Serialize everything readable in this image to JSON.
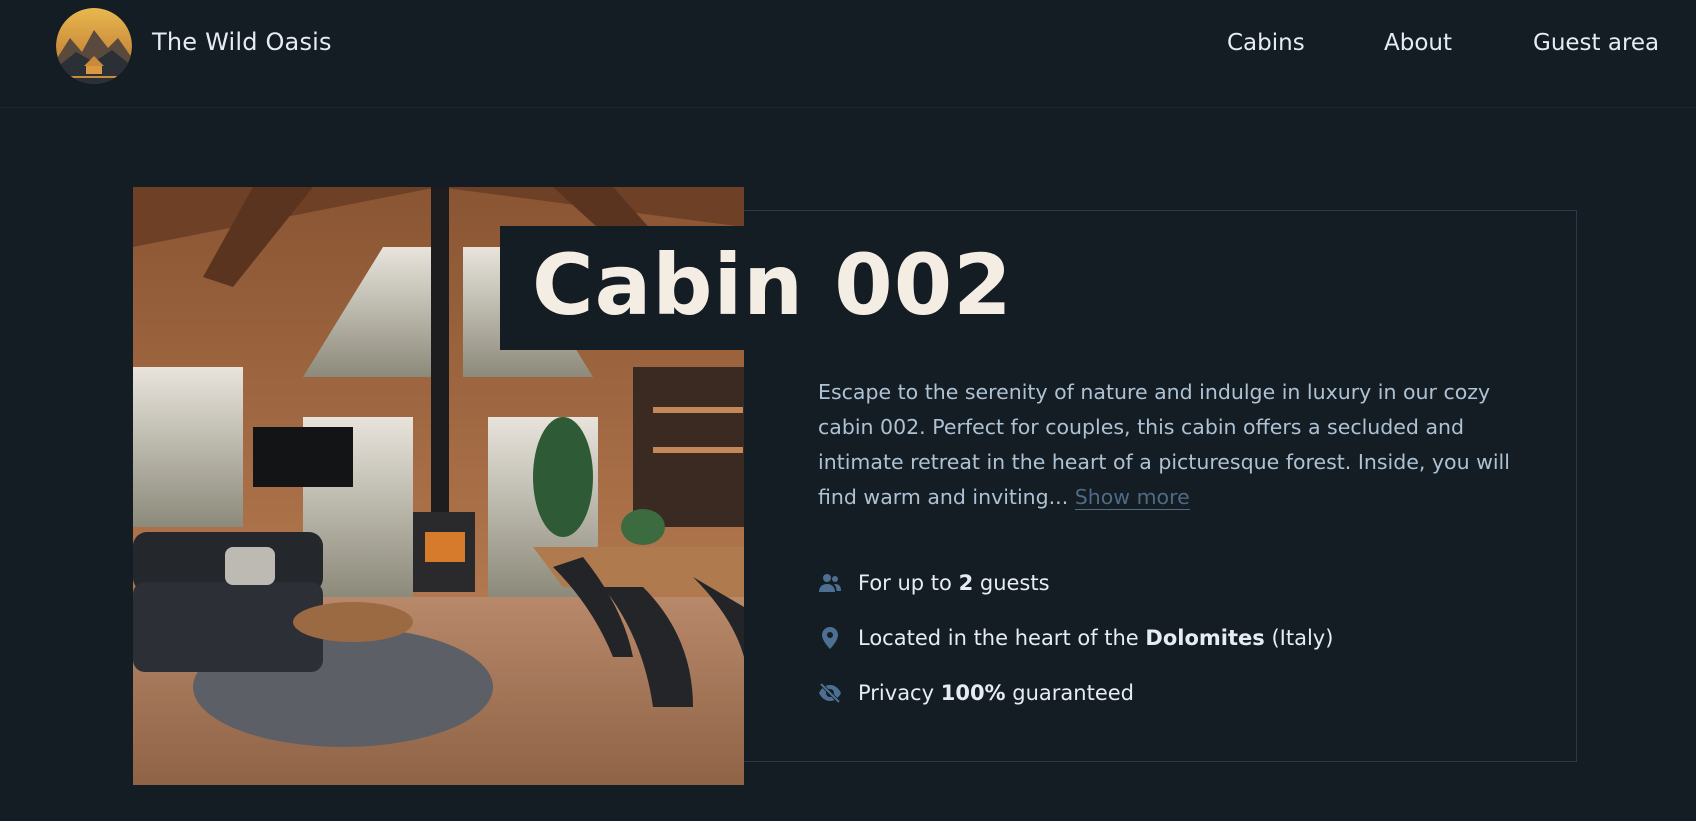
{
  "header": {
    "brand": "The Wild Oasis",
    "nav": [
      {
        "label": "Cabins"
      },
      {
        "label": "About"
      },
      {
        "label": "Guest area"
      }
    ]
  },
  "cabin": {
    "title": "Cabin 002",
    "description": "Escape to the serenity of nature and indulge in luxury in our cozy cabin 002. Perfect for couples, this cabin offers a secluded and intimate retreat in the heart of a picturesque forest. Inside, you will find warm and inviting...",
    "show_more": "Show more",
    "features": {
      "guests": {
        "prefix": "For up to ",
        "value": "2",
        "suffix": " guests",
        "icon": "users-icon"
      },
      "location": {
        "prefix": "Located in the heart of the ",
        "value": "Dolomites",
        "suffix": " (Italy)",
        "icon": "map-pin-icon"
      },
      "privacy": {
        "prefix": "Privacy ",
        "value": "100%",
        "suffix": " guaranteed",
        "icon": "eye-slash-icon"
      }
    }
  },
  "colors": {
    "background": "#141c24",
    "title": "#f4ede3",
    "text": "#aec2d3",
    "muted": "#4f6a85",
    "icon": "#4d6f91"
  }
}
